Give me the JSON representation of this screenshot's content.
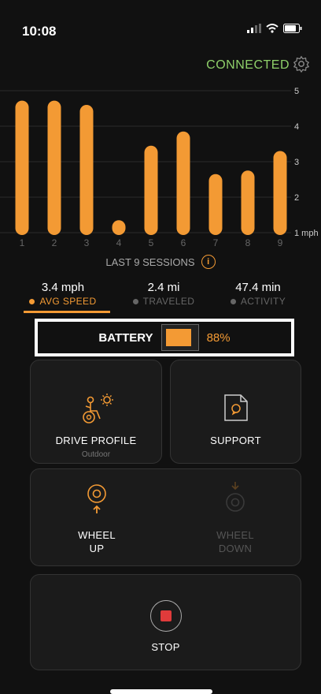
{
  "status_bar": {
    "time": "10:08"
  },
  "header": {
    "connection_status": "CONNECTED",
    "connected_color": "#8fd06a"
  },
  "chart_data": {
    "type": "bar",
    "categories": [
      "1",
      "2",
      "3",
      "4",
      "5",
      "6",
      "7",
      "8",
      "9"
    ],
    "values": [
      4.72,
      4.72,
      4.6,
      1.35,
      3.45,
      3.85,
      2.65,
      2.75,
      3.3
    ],
    "ylim": [
      1,
      5
    ],
    "y_ticks": [
      "1 mph",
      "2",
      "3",
      "4",
      "5"
    ],
    "xlabel": "LAST 9 SESSIONS",
    "bar_color": "#f39a34",
    "grid": true
  },
  "metrics": [
    {
      "value": "3.4 mph",
      "label": "AVG SPEED",
      "active": true
    },
    {
      "value": "2.4 mi",
      "label": "TRAVELED",
      "active": false
    },
    {
      "value": "47.4 min",
      "label": "ACTIVITY",
      "active": false
    }
  ],
  "battery": {
    "label": "BATTERY",
    "percent_text": "88%",
    "level": 0.88
  },
  "cards": {
    "drive_profile": {
      "title": "DRIVE PROFILE",
      "subtitle": "Outdoor"
    },
    "support": {
      "title": "SUPPORT"
    },
    "wheel_up": {
      "line1": "WHEEL",
      "line2": "UP"
    },
    "wheel_down": {
      "line1": "WHEEL",
      "line2": "DOWN"
    },
    "stop": {
      "title": "STOP"
    }
  },
  "colors": {
    "accent": "#f39a34",
    "stop": "#e03b3b"
  }
}
